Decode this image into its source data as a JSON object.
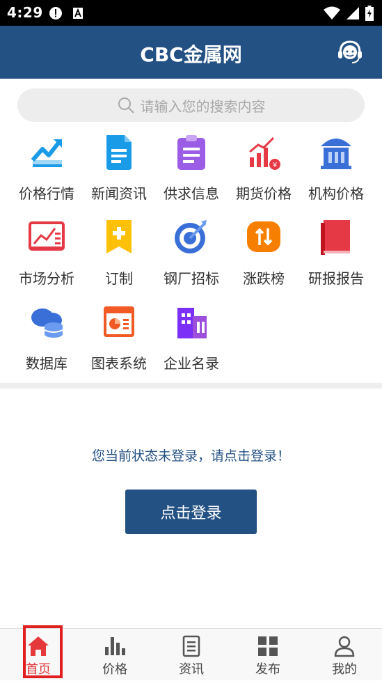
{
  "status_bar": {
    "time": "4:29",
    "icons": [
      "alert-icon",
      "a-box-icon",
      "wifi-icon",
      "signal-icon",
      "battery-icon"
    ]
  },
  "header": {
    "title": "CBC金属网",
    "service_icon": "customer-service-icon"
  },
  "search": {
    "placeholder": "请输入您的搜索内容"
  },
  "grid": [
    {
      "label": "价格行情",
      "icon": "trend-chart-icon"
    },
    {
      "label": "新闻资讯",
      "icon": "news-document-icon"
    },
    {
      "label": "供求信息",
      "icon": "clipboard-icon"
    },
    {
      "label": "期货价格",
      "icon": "futures-chart-icon"
    },
    {
      "label": "机构价格",
      "icon": "institution-building-icon"
    },
    {
      "label": "市场分析",
      "icon": "market-analysis-icon"
    },
    {
      "label": "订制",
      "icon": "bookmark-plus-icon"
    },
    {
      "label": "钢厂招标",
      "icon": "target-icon"
    },
    {
      "label": "涨跌榜",
      "icon": "up-down-arrows-icon"
    },
    {
      "label": "研报报告",
      "icon": "report-book-icon"
    },
    {
      "label": "数据库",
      "icon": "database-cloud-icon"
    },
    {
      "label": "图表系统",
      "icon": "chart-window-icon"
    },
    {
      "label": "企业名录",
      "icon": "company-building-icon"
    }
  ],
  "login": {
    "message": "您当前状态未登录，请点击登录！",
    "button_label": "点击登录"
  },
  "bottom_nav": [
    {
      "label": "首页",
      "icon": "home-icon",
      "active": true
    },
    {
      "label": "价格",
      "icon": "bar-chart-icon",
      "active": false
    },
    {
      "label": "资讯",
      "icon": "document-list-icon",
      "active": false
    },
    {
      "label": "发布",
      "icon": "grid-squares-icon",
      "active": false
    },
    {
      "label": "我的",
      "icon": "user-icon",
      "active": false
    }
  ],
  "colors": {
    "brand": "#245183",
    "active_nav": "#e5383b",
    "highlight_outline": "#e02020"
  }
}
